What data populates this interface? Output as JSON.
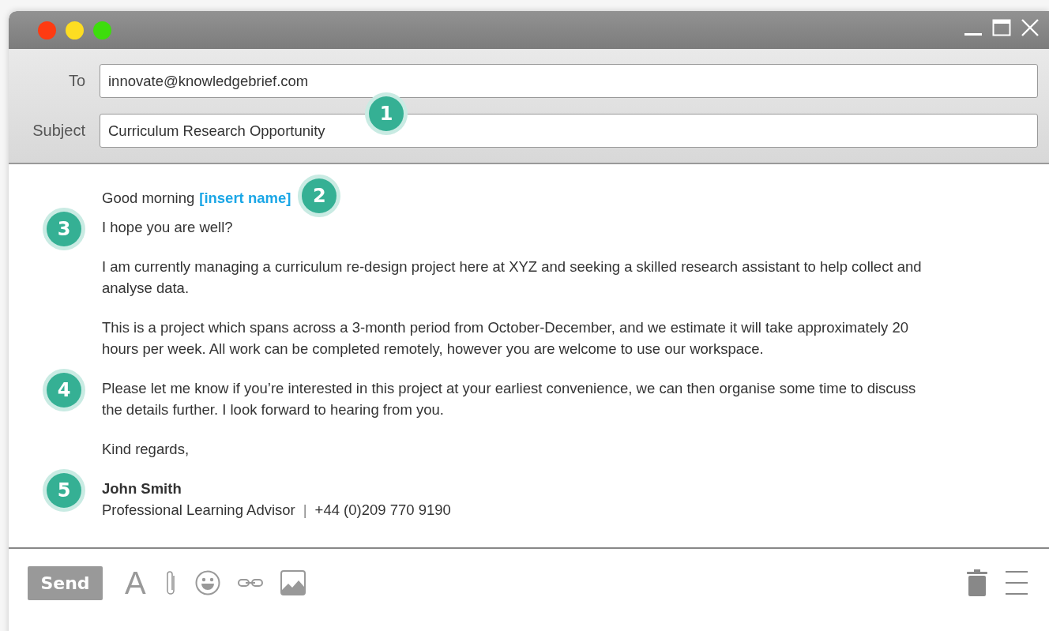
{
  "header": {
    "fields": [
      {
        "label": "To",
        "value": "innovate@knowledgebrief.com"
      },
      {
        "label": "Subject",
        "value": "Curriculum Research Opportunity",
        "badge": "1"
      }
    ]
  },
  "body": {
    "greeting": {
      "text": "Good morning",
      "name_tag": "[insert name]",
      "badge": "2"
    },
    "paragraphs": [
      {
        "text": "I hope you are well?",
        "badge": "3"
      },
      {
        "text": "I am currently managing a curriculum re-design project here at XYZ and seeking a skilled research assistant to help collect and analyse data."
      },
      {
        "text": "This is a project which spans across a 3-month period from October-December, and we estimate it will take approximately 20 hours per week. All work can be completed remotely, however you are welcome to use our workspace."
      },
      {
        "text": "Please let me know if you’re interested in this project at your earliest convenience, we can then organise some time to discuss the details further. I look forward to hearing from you.",
        "badge": "4"
      },
      {
        "text": "Kind regards,"
      }
    ],
    "signature": {
      "name": "John Smith",
      "title": "Professional Learning Advisor",
      "separator": "|",
      "phone": "+44 (0)209 770 9190",
      "badge": "5"
    }
  },
  "footer": {
    "send": "Send",
    "format": "A"
  }
}
